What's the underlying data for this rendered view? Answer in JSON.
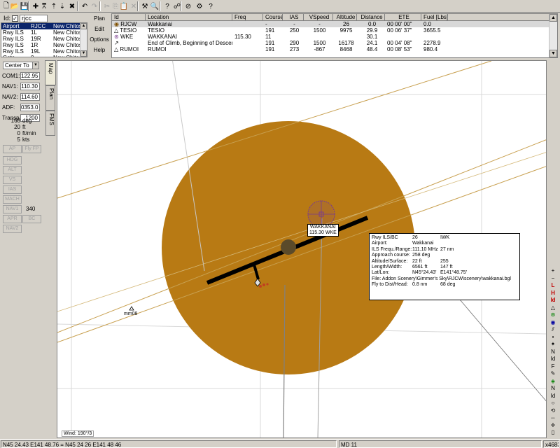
{
  "toolbar": {
    "buttons": [
      {
        "name": "new-file-icon",
        "glyph": "🗋"
      },
      {
        "name": "open-folder-icon",
        "glyph": "📂"
      },
      {
        "name": "save-icon",
        "glyph": "💾"
      },
      {
        "name": "add-waypoint-icon",
        "glyph": "✚"
      },
      {
        "name": "airport-icon",
        "glyph": "⩞"
      },
      {
        "name": "move-up-icon",
        "glyph": "⇡"
      },
      {
        "name": "move-down-icon",
        "glyph": "⇣"
      },
      {
        "name": "delete-icon",
        "glyph": "✖"
      },
      {
        "name": "undo-icon",
        "glyph": "↶"
      },
      {
        "name": "redo-icon",
        "glyph": "↷"
      },
      {
        "name": "cut-icon",
        "glyph": "✂"
      },
      {
        "name": "copy-icon",
        "glyph": "⎘"
      },
      {
        "name": "paste-icon",
        "glyph": "📋"
      },
      {
        "name": "clear-icon",
        "glyph": "✕"
      },
      {
        "name": "hammer-icon",
        "glyph": "⚒"
      },
      {
        "name": "find-icon",
        "glyph": "🔍"
      },
      {
        "name": "help-icon",
        "glyph": "?"
      },
      {
        "name": "route-icon",
        "glyph": "☍"
      },
      {
        "name": "no-signal-icon",
        "glyph": "⊘"
      },
      {
        "name": "settings-icon",
        "glyph": "⚙"
      },
      {
        "name": "about-icon",
        "glyph": "?"
      }
    ]
  },
  "airport_panel": {
    "id_label": "Id:",
    "id_checked": "✓",
    "id_value": "rjcc",
    "rows": [
      {
        "type": "Airport",
        "code": "RJCC",
        "name": "New Chitose"
      },
      {
        "type": "Rwy ILS",
        "code": "1L",
        "name": "New Chitose"
      },
      {
        "type": "Rwy ILS",
        "code": "19R",
        "name": "New Chitose"
      },
      {
        "type": "Rwy ILS",
        "code": "1R",
        "name": "New Chitose"
      },
      {
        "type": "Rwy ILS",
        "code": "19L",
        "name": "New Chitose"
      },
      {
        "type": "Gate",
        "code": "0",
        "name": "New Chitose"
      }
    ]
  },
  "fp_menu": {
    "items": [
      "Plan",
      "Edit",
      "Options",
      "Help"
    ]
  },
  "flight_plan": {
    "columns": [
      "Id",
      "Location",
      "Freq",
      "Course",
      "IAS",
      "VSpeed",
      "Altitude",
      "Distance",
      "ETE",
      "Fuel [Lbs]"
    ],
    "rows": [
      {
        "icon": "airport-icon",
        "glyph": "◉",
        "id": "RJCW",
        "location": "Wakkanai",
        "freq": "",
        "course": "-",
        "ias": "-",
        "vspeed": "-",
        "altitude": "26",
        "distance": "0.0",
        "ete": "00 00' 00\"",
        "fuel": "0.0"
      },
      {
        "icon": "ndb-icon",
        "glyph": "△",
        "id": "TESIO",
        "location": "TESIO",
        "freq": "",
        "course": "191",
        "ias": "250",
        "vspeed": "1500",
        "altitude": "9975",
        "distance": "29.9",
        "ete": "00 06' 37\"",
        "fuel": "3655.5"
      },
      {
        "icon": "vor-icon",
        "glyph": "⊛",
        "id": "WKE",
        "location": "WAKKANAI",
        "freq": "115.30",
        "course": "11",
        "ias": "",
        "vspeed": "",
        "altitude": "",
        "distance": "30.1",
        "ete": "",
        "fuel": ""
      },
      {
        "icon": "climb-icon",
        "glyph": "↗",
        "id": "",
        "location": "End of Climb, Beginning of Descent",
        "freq": "",
        "course": "191",
        "ias": "290",
        "vspeed": "1500",
        "altitude": "16178",
        "distance": "24.1",
        "ete": "00 04' 08\"",
        "fuel": "2278.9"
      },
      {
        "icon": "ndb-icon",
        "glyph": "△",
        "id": "RUMOI",
        "location": "RUMOI",
        "freq": "",
        "course": "191",
        "ias": "273",
        "vspeed": "-867",
        "altitude": "8468",
        "distance": "48.4",
        "ete": "00 08' 53\"",
        "fuel": "980.4"
      }
    ]
  },
  "instruments": {
    "center_mode": "Center To",
    "radios": [
      {
        "label": "COM1:",
        "value": "122.95"
      },
      {
        "label": "NAV1:",
        "value": "110.30"
      },
      {
        "label": "NAV2:",
        "value": "114.60"
      },
      {
        "label": "ADF:",
        "value": "0353.0"
      },
      {
        "label": "Transp.:",
        "value": "1200"
      }
    ],
    "stats": [
      {
        "num": "168",
        "unit": "deg"
      },
      {
        "num": "20",
        "unit": "ft"
      },
      {
        "num": "0",
        "unit": "ft/min"
      },
      {
        "num": "5",
        "unit": "kts"
      }
    ],
    "autopilot": {
      "ap": "AP",
      "fly_fp": "Fly FP",
      "hdg": "HDG",
      "alt": "ALT",
      "vs": "VS",
      "ias": "IAS",
      "mach": "MACH",
      "nav1": "NAV1",
      "nav1_value": "340",
      "apr": "APR",
      "bc": "BC",
      "nav2": "NAV2"
    }
  },
  "tabs": [
    "Map",
    "Plan",
    "FMS"
  ],
  "map": {
    "wind": "Wind: 190°/3",
    "vor_name": "WAKKANAI",
    "vor_freq": "115.30 WKE",
    "ndb_label": "mm08",
    "colors": {
      "airport_disc": "#b87a14",
      "route": "#c8a050",
      "grid": "#d8d8d8",
      "vor": "#7a3c8c"
    },
    "info": {
      "rows": [
        {
          "k": "Rwy ILS/BC",
          "v1": "26",
          "v2": "IWK"
        },
        {
          "k": "Airport:",
          "v1": "Wakkanai",
          "v2": ""
        },
        {
          "k": "ILS Frequ./Range:",
          "v1": "111.10 MHz",
          "v2": "27 nm"
        },
        {
          "k": "Approach course:",
          "v1": "258 deg",
          "v2": ""
        },
        {
          "k": "Altitude/Surface:",
          "v1": "22 ft",
          "v2": "255"
        },
        {
          "k": "Length/Width:",
          "v1": "6561 ft",
          "v2": "147 ft"
        },
        {
          "k": "Lat/Lon:",
          "v1": "N45°24.43'",
          "v2": "E141°48.75'"
        }
      ],
      "file": "File: Addon Scenery\\Gimmer's Sky\\RJCW\\scenery\\wakkanai.bgl",
      "fly_to": {
        "k": "Fly to Dist/Head:",
        "v1": "0.8 nm",
        "v2": "68 deg"
      }
    }
  },
  "right_tools": [
    {
      "name": "zoom-in-icon",
      "glyph": "+",
      "cls": ""
    },
    {
      "name": "zoom-out-icon",
      "glyph": "−",
      "cls": ""
    },
    {
      "name": "layer-l-icon",
      "glyph": "L",
      "cls": "red"
    },
    {
      "name": "layer-h-icon",
      "glyph": "H",
      "cls": "red"
    },
    {
      "name": "layer-id-icon",
      "glyph": "Id",
      "cls": "red"
    },
    {
      "name": "ndb-filter-icon",
      "glyph": "△",
      "cls": ""
    },
    {
      "name": "vor-filter-icon",
      "glyph": "⊛",
      "cls": "green"
    },
    {
      "name": "airport-filter-icon",
      "glyph": "◉",
      "cls": "blue"
    },
    {
      "name": "runway-filter-icon",
      "glyph": "⫽",
      "cls": ""
    },
    {
      "name": "marker-filter-icon",
      "glyph": "•",
      "cls": ""
    },
    {
      "name": "fix-filter-icon",
      "glyph": "✦",
      "cls": ""
    },
    {
      "name": "layer-n-icon",
      "glyph": "N",
      "cls": ""
    },
    {
      "name": "layer-id2-icon",
      "glyph": "Id",
      "cls": ""
    },
    {
      "name": "layer-f-icon",
      "glyph": "F",
      "cls": ""
    },
    {
      "name": "pencil-icon",
      "glyph": "✎",
      "cls": ""
    },
    {
      "name": "gps-icon",
      "glyph": "◈",
      "cls": "green"
    },
    {
      "name": "layer-n2-icon",
      "glyph": "N",
      "cls": ""
    },
    {
      "name": "layer-id3-icon",
      "glyph": "Id",
      "cls": ""
    },
    {
      "name": "circle-icon",
      "glyph": "○",
      "cls": ""
    },
    {
      "name": "rotate-icon",
      "glyph": "⟲",
      "cls": ""
    },
    {
      "name": "pan-icon",
      "glyph": "⇔",
      "cls": ""
    },
    {
      "name": "center-icon",
      "glyph": "✛",
      "cls": ""
    },
    {
      "name": "page-icon",
      "glyph": "▯",
      "cls": ""
    }
  ],
  "status": {
    "position": "N45 24.43  E141 48.76  =  N45 24 26  E141 48 46",
    "mode": "MD 11",
    "zoom": "x4683"
  }
}
